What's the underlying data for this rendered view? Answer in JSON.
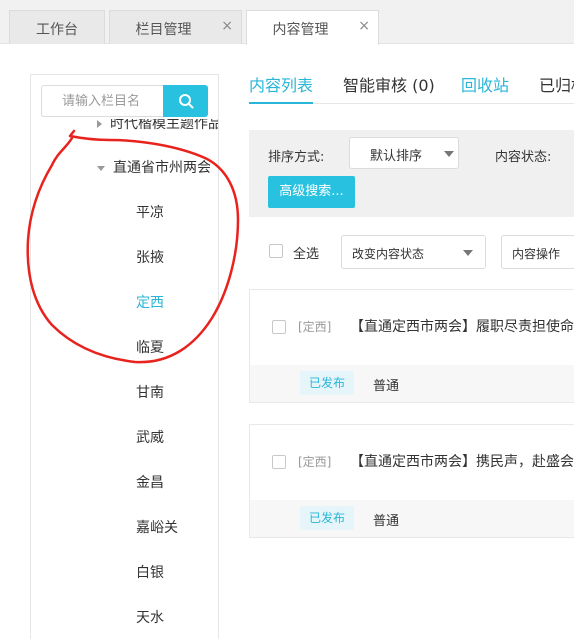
{
  "top_tabs": [
    {
      "label": "工作台",
      "closable": false,
      "active": false
    },
    {
      "label": "栏目管理",
      "closable": true,
      "active": false
    },
    {
      "label": "内容管理",
      "closable": true,
      "active": true
    }
  ],
  "close_glyph": "×",
  "sidebar": {
    "search_placeholder": "请输入栏目名",
    "partial_item": "时代楷模主题作品",
    "parent": "直通省市州两会",
    "children": [
      "平凉",
      "张掖",
      "定西",
      "临夏",
      "甘南",
      "武威",
      "金昌",
      "嘉峪关",
      "白银",
      "天水"
    ],
    "active_child": "定西"
  },
  "content_tabs": {
    "list": "内容列表",
    "review": "智能审核 (0)",
    "recycle": "回收站",
    "archived": "已归档"
  },
  "filters": {
    "sort_label": "排序方式:",
    "sort_value": "默认排序",
    "status_label": "内容状态:",
    "advanced_search": "高级搜索..."
  },
  "bulk": {
    "select_all": "全选",
    "change_status": "改变内容状态",
    "content_ops": "内容操作"
  },
  "items": [
    {
      "tag": "[定西]",
      "title": "【直通定西市两会】履职尽责担使命",
      "status": "已发布",
      "level": "普通"
    },
    {
      "tag": "[定西]",
      "title": "【直通定西市两会】携民声，赴盛会",
      "status": "已发布",
      "level": "普通"
    }
  ],
  "colors": {
    "accent": "#29b6d8",
    "button": "#29c1e0",
    "annotation": "#e8231e"
  },
  "icons": {
    "search": "search-icon",
    "close": "close-icon",
    "tree_expanded": "caret-down-icon",
    "tree_collapsed": "caret-right-icon",
    "dropdown": "caret-down-icon"
  }
}
